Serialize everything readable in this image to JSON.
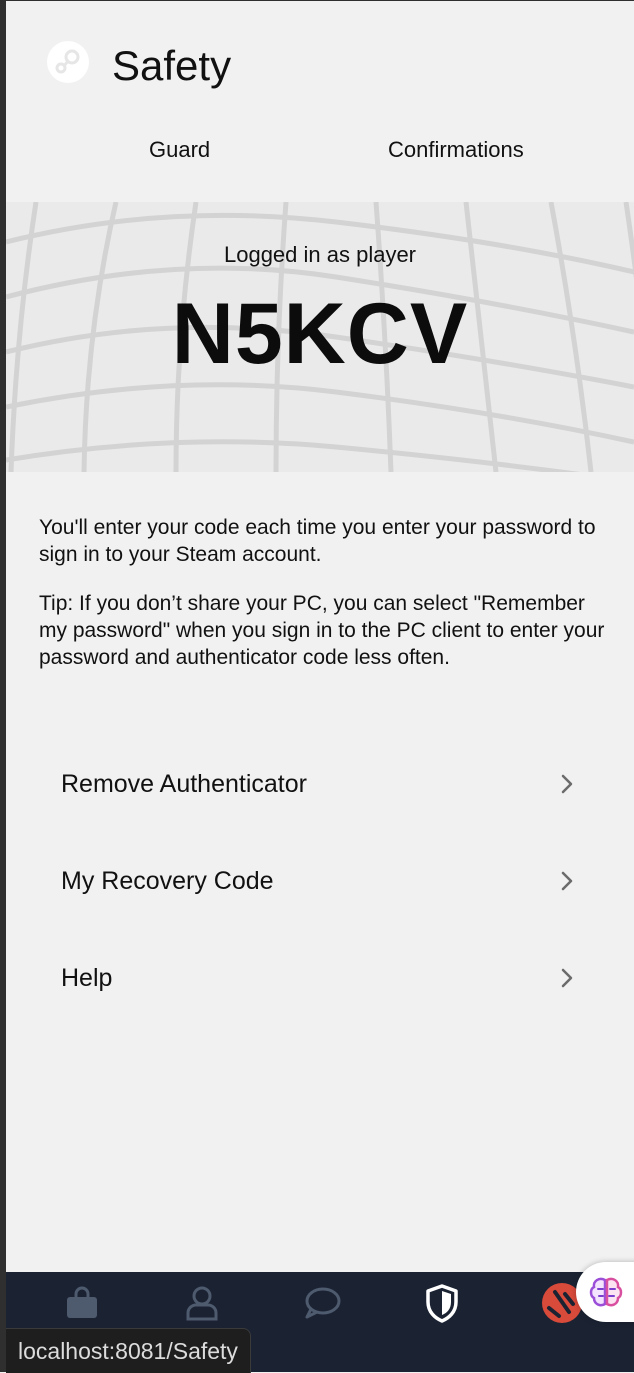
{
  "header": {
    "title": "Safety",
    "logo_icon": "steam-logo-icon"
  },
  "tabs": [
    {
      "label": "Guard"
    },
    {
      "label": "Confirmations"
    }
  ],
  "hero": {
    "subtitle": "Logged in as player",
    "code": "N5KCV"
  },
  "description": {
    "paragraph_1": "You'll enter your code each time you enter your password to sign in to your Steam account.",
    "paragraph_2": "Tip: If you don’t share your PC, you can select \"Remember my password\" when you sign in to the PC client to enter your password and authenticator code less often."
  },
  "menu": [
    {
      "label": "Remove Authenticator",
      "icon": "chevron-right-icon"
    },
    {
      "label": "My Recovery Code",
      "icon": "chevron-right-icon"
    },
    {
      "label": "Help",
      "icon": "chevron-right-icon"
    }
  ],
  "navbar": {
    "items": [
      {
        "icon": "store-bag-icon"
      },
      {
        "icon": "profile-icon"
      },
      {
        "icon": "chat-icon"
      },
      {
        "icon": "shield-icon",
        "active": true
      },
      {
        "icon": "avatar-icon"
      }
    ]
  },
  "assistant": {
    "icon": "brain-icon"
  },
  "status_bar": {
    "url": "localhost:8081/Safety"
  },
  "colors": {
    "background": "#f1f1f1",
    "navbar": "#1b2333",
    "nav_inactive": "#4e5a6e",
    "nav_active": "#ffffff",
    "avatar": "#d84a3a"
  }
}
